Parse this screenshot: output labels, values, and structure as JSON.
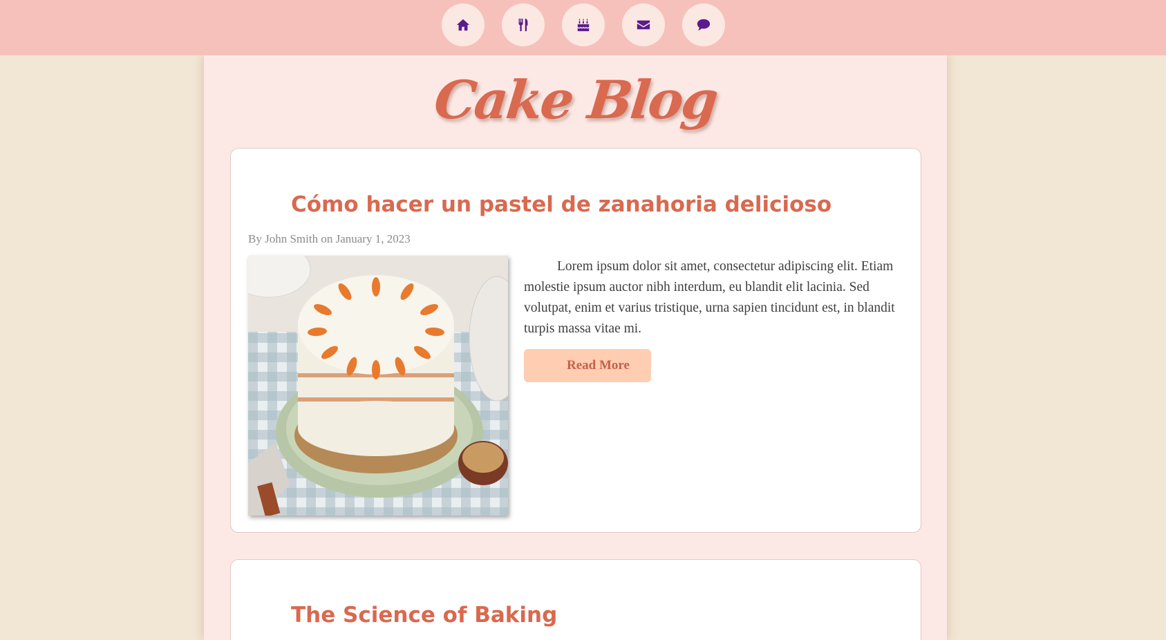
{
  "nav": {
    "items": [
      {
        "icon": "home-icon",
        "name": "nav-home-button"
      },
      {
        "icon": "utensils-icon",
        "name": "nav-recipes-button"
      },
      {
        "icon": "cake-icon",
        "name": "nav-cakes-button"
      },
      {
        "icon": "envelope-icon",
        "name": "nav-contact-button"
      },
      {
        "icon": "comment-icon",
        "name": "nav-comments-button"
      }
    ]
  },
  "site": {
    "title": "Cake Blog"
  },
  "posts": [
    {
      "title": "Cómo hacer un pastel de zanahoria delicioso",
      "byline": "By John Smith on January 1, 2023",
      "excerpt": "Lorem ipsum dolor sit amet, consectetur adipiscing elit. Etiam molestie ipsum auctor nibh interdum, eu blandit elit lacinia. Sed volutpat, enim et varius tristique, urna sapien tincidunt est, in blandit turpis massa vitae mi.",
      "read_more": "Read More",
      "image": "carrot-cake-photo"
    },
    {
      "title": "The Science of Baking"
    }
  ],
  "colors": {
    "accent": "#d9694f",
    "nav_bg": "#f6c1ba",
    "icon": "#5a1b8c",
    "button_bg": "#ffcdb2",
    "page_bg": "#f2e6d4"
  }
}
